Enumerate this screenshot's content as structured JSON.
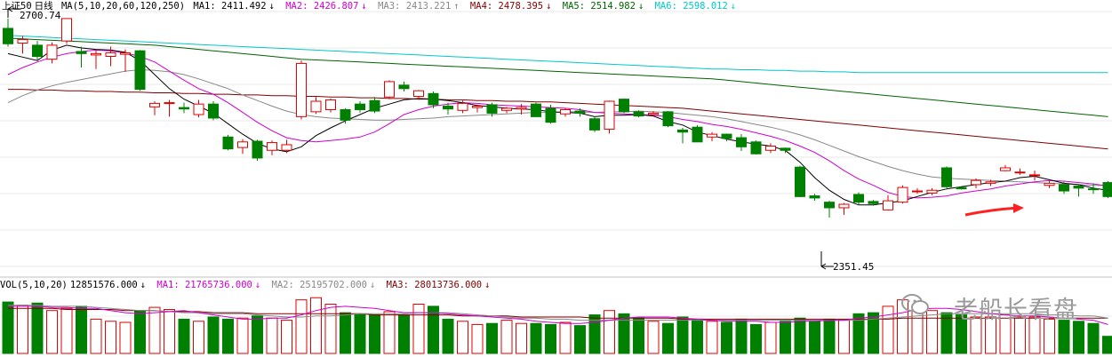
{
  "index_name": "上证50",
  "period": "日线",
  "ma_header": {
    "label": "MA(5,10,20,60,120,250)",
    "items": [
      {
        "name": "MA1",
        "value": "2411.492",
        "arrow": "↓",
        "color": "#000000"
      },
      {
        "name": "MA2",
        "value": "2426.807",
        "arrow": "↓",
        "color": "#d000d0"
      },
      {
        "name": "MA3",
        "value": "2413.221",
        "arrow": "↑",
        "color": "#888888"
      },
      {
        "name": "MA4",
        "value": "2478.395",
        "arrow": "↓",
        "color": "#800000"
      },
      {
        "name": "MA5",
        "value": "2514.982",
        "arrow": "↓",
        "color": "#006400"
      },
      {
        "name": "MA6",
        "value": "2598.012",
        "arrow": "↓",
        "color": "#00c8c8"
      }
    ]
  },
  "price_annotations": {
    "high_label": "2700.74",
    "low_label": "2351.45"
  },
  "vol_header": {
    "label": "VOL(5,10,20)",
    "value": "12851576.000",
    "arrow": "↓",
    "items": [
      {
        "name": "MA1",
        "value": "21765736.000",
        "arrow": "↓",
        "color": "#d000d0"
      },
      {
        "name": "MA2",
        "value": "25195702.000",
        "arrow": "↓",
        "color": "#888888"
      },
      {
        "name": "MA3",
        "value": "28013736.000",
        "arrow": "↓",
        "color": "#800000"
      }
    ]
  },
  "watermark": "老船长看盘",
  "colors": {
    "up": "#e00000",
    "down": "#008000",
    "ma_fast": "#000000",
    "ma_mid": "#d000d0",
    "ma_slow": "#888888",
    "ma60": "#800000",
    "ma120": "#006400",
    "ma250": "#00c8c8",
    "arrow": "#ff2020"
  },
  "chart_data": {
    "type": "candlestick",
    "price_range": [
      2340,
      2710
    ],
    "candles": [
      [
        2686,
        2664,
        2700,
        2660
      ],
      [
        2665,
        2670,
        2675,
        2650
      ],
      [
        2662,
        2646,
        2668,
        2640
      ],
      [
        2642,
        2662,
        2666,
        2636
      ],
      [
        2668,
        2700,
        2700,
        2664
      ],
      [
        2653,
        2650,
        2660,
        2630
      ],
      [
        2648,
        2650,
        2655,
        2628
      ],
      [
        2646,
        2651,
        2660,
        2632
      ],
      [
        2649,
        2651,
        2656,
        2624
      ],
      [
        2654,
        2599,
        2655,
        2597
      ],
      [
        2574,
        2579,
        2582,
        2562
      ],
      [
        2579,
        2580,
        2584,
        2560
      ],
      [
        2573,
        2571,
        2580,
        2565
      ],
      [
        2563,
        2578,
        2584,
        2559
      ],
      [
        2578,
        2558,
        2582,
        2555
      ],
      [
        2531,
        2514,
        2534,
        2512
      ],
      [
        2516,
        2524,
        2528,
        2507
      ],
      [
        2525,
        2501,
        2527,
        2497
      ],
      [
        2512,
        2523,
        2526,
        2505
      ],
      [
        2512,
        2520,
        2527,
        2508
      ],
      [
        2560,
        2636,
        2640,
        2556
      ],
      [
        2567,
        2582,
        2588,
        2564
      ],
      [
        2570,
        2584,
        2586,
        2566
      ],
      [
        2570,
        2555,
        2572,
        2550
      ],
      [
        2578,
        2570,
        2582,
        2566
      ],
      [
        2583,
        2568,
        2588,
        2565
      ],
      [
        2588,
        2610,
        2612,
        2585
      ],
      [
        2605,
        2600,
        2610,
        2596
      ],
      [
        2589,
        2597,
        2598,
        2584
      ],
      [
        2593,
        2577,
        2596,
        2572
      ],
      [
        2575,
        2571,
        2580,
        2563
      ],
      [
        2569,
        2579,
        2583,
        2565
      ],
      [
        2573,
        2575,
        2577,
        2566
      ],
      [
        2577,
        2565,
        2580,
        2560
      ],
      [
        2569,
        2572,
        2574,
        2565
      ],
      [
        2571,
        2573,
        2578,
        2563
      ],
      [
        2578,
        2560,
        2580,
        2560
      ],
      [
        2572,
        2552,
        2577,
        2550
      ],
      [
        2564,
        2570,
        2572,
        2560
      ],
      [
        2568,
        2565,
        2572,
        2560
      ],
      [
        2557,
        2541,
        2560,
        2538
      ],
      [
        2542,
        2582,
        2583,
        2536
      ],
      [
        2585,
        2567,
        2586,
        2565
      ],
      [
        2567,
        2561,
        2569,
        2559
      ],
      [
        2563,
        2565,
        2568,
        2560
      ],
      [
        2567,
        2547,
        2568,
        2545
      ],
      [
        2541,
        2538,
        2544,
        2522
      ],
      [
        2545,
        2524,
        2548,
        2524
      ],
      [
        2531,
        2535,
        2538,
        2525
      ],
      [
        2535,
        2529,
        2536,
        2525
      ],
      [
        2530,
        2517,
        2535,
        2511
      ],
      [
        2524,
        2507,
        2526,
        2506
      ],
      [
        2512,
        2518,
        2522,
        2508
      ],
      [
        2515,
        2512,
        2516,
        2508
      ],
      [
        2488,
        2446,
        2490,
        2445
      ],
      [
        2447,
        2444,
        2450,
        2440
      ],
      [
        2438,
        2430,
        2440,
        2416
      ],
      [
        2430,
        2435,
        2437,
        2420
      ],
      [
        2449,
        2438,
        2452,
        2434
      ],
      [
        2439,
        2436,
        2441,
        2433
      ],
      [
        2427,
        2440,
        2448,
        2426
      ],
      [
        2438,
        2459,
        2462,
        2436
      ],
      [
        2453,
        2454,
        2458,
        2450
      ],
      [
        2451,
        2455,
        2458,
        2448
      ],
      [
        2487,
        2460,
        2489,
        2458
      ],
      [
        2459,
        2457,
        2460,
        2456
      ],
      [
        2463,
        2469,
        2472,
        2458
      ],
      [
        2465,
        2467,
        2470,
        2461
      ],
      [
        2483,
        2487,
        2491,
        2482
      ],
      [
        2481,
        2481,
        2486,
        2477
      ],
      [
        2476,
        2477,
        2483,
        2469
      ],
      [
        2462,
        2465,
        2468,
        2458
      ],
      [
        2463,
        2454,
        2467,
        2450
      ],
      [
        2461,
        2458,
        2464,
        2446
      ],
      [
        2457,
        2456,
        2465,
        2450
      ],
      [
        2466,
        2446,
        2468,
        2444
      ]
    ],
    "ma_fast": [
      2650,
      2645,
      2640,
      2655,
      2662,
      2658,
      2656,
      2655,
      2652,
      2640,
      2620,
      2600,
      2585,
      2575,
      2565,
      2550,
      2535,
      2522,
      2514,
      2510,
      2517,
      2533,
      2544,
      2554,
      2563,
      2572,
      2578,
      2584,
      2586,
      2585,
      2583,
      2580,
      2576,
      2574,
      2572,
      2571,
      2570,
      2567,
      2566,
      2565,
      2560,
      2562,
      2562,
      2563,
      2561,
      2553,
      2548,
      2538,
      2533,
      2528,
      2524,
      2521,
      2518,
      2512,
      2495,
      2473,
      2455,
      2442,
      2434,
      2434,
      2437,
      2440,
      2446,
      2452,
      2457,
      2460,
      2463,
      2466,
      2468,
      2473,
      2475,
      2470,
      2465,
      2463,
      2458,
      2455
    ],
    "ma_mid": [
      2620,
      2630,
      2638,
      2645,
      2650,
      2653,
      2655,
      2654,
      2651,
      2646,
      2638,
      2625,
      2612,
      2600,
      2592,
      2580,
      2566,
      2552,
      2540,
      2530,
      2526,
      2524,
      2526,
      2528,
      2531,
      2538,
      2550,
      2563,
      2570,
      2575,
      2578,
      2580,
      2579,
      2577,
      2576,
      2575,
      2574,
      2573,
      2572,
      2570,
      2566,
      2565,
      2564,
      2563,
      2562,
      2560,
      2556,
      2553,
      2549,
      2546,
      2542,
      2537,
      2532,
      2526,
      2518,
      2509,
      2497,
      2483,
      2471,
      2462,
      2452,
      2446,
      2444,
      2445,
      2447,
      2451,
      2454,
      2457,
      2461,
      2464,
      2467,
      2469,
      2468,
      2466,
      2464,
      2461
    ],
    "ma_slow": [
      2580,
      2590,
      2598,
      2604,
      2609,
      2613,
      2617,
      2621,
      2625,
      2627,
      2626,
      2624,
      2620,
      2614,
      2607,
      2600,
      2591,
      2583,
      2575,
      2568,
      2563,
      2560,
      2558,
      2557,
      2556,
      2555,
      2555,
      2556,
      2557,
      2558,
      2560,
      2561,
      2562,
      2563,
      2564,
      2565,
      2566,
      2566,
      2567,
      2567,
      2566,
      2567,
      2567,
      2568,
      2567,
      2566,
      2564,
      2562,
      2560,
      2557,
      2553,
      2549,
      2545,
      2540,
      2534,
      2527,
      2519,
      2511,
      2503,
      2496,
      2489,
      2483,
      2478,
      2474,
      2472,
      2471,
      2470,
      2469,
      2468,
      2467,
      2466,
      2465,
      2464,
      2463,
      2462,
      2462
    ],
    "ma60": [
      2599,
      2599,
      2598,
      2598,
      2597,
      2597,
      2596,
      2596,
      2595,
      2595,
      2594,
      2594,
      2593,
      2593,
      2592,
      2592,
      2591,
      2591,
      2590,
      2590,
      2589,
      2589,
      2588,
      2588,
      2587,
      2587,
      2586,
      2586,
      2585,
      2585,
      2584,
      2584,
      2583,
      2583,
      2582,
      2582,
      2581,
      2581,
      2580,
      2579,
      2578,
      2577,
      2576,
      2575,
      2574,
      2573,
      2572,
      2570,
      2568,
      2566,
      2564,
      2562,
      2560,
      2558,
      2556,
      2554,
      2552,
      2550,
      2548,
      2546,
      2544,
      2542,
      2540,
      2538,
      2536,
      2534,
      2532,
      2530,
      2528,
      2526,
      2524,
      2522,
      2520,
      2518,
      2516,
      2514
    ],
    "ma120": [
      2672,
      2671,
      2670,
      2669,
      2668,
      2667,
      2666,
      2665,
      2664,
      2663,
      2662,
      2660,
      2658,
      2656,
      2654,
      2652,
      2650,
      2648,
      2646,
      2644,
      2642,
      2641,
      2640,
      2639,
      2638,
      2637,
      2636,
      2635,
      2634,
      2633,
      2632,
      2631,
      2630,
      2629,
      2628,
      2627,
      2626,
      2625,
      2624,
      2623,
      2622,
      2621,
      2620,
      2619,
      2618,
      2617,
      2616,
      2615,
      2614,
      2612,
      2610,
      2608,
      2606,
      2604,
      2602,
      2600,
      2598,
      2596,
      2594,
      2592,
      2590,
      2588,
      2586,
      2584,
      2582,
      2580,
      2578,
      2576,
      2574,
      2572,
      2570,
      2568,
      2566,
      2564,
      2562,
      2560
    ],
    "ma250": [
      2676,
      2675,
      2674,
      2673,
      2672,
      2671,
      2670,
      2669,
      2668,
      2667,
      2666,
      2665,
      2664,
      2663,
      2662,
      2661,
      2660,
      2659,
      2658,
      2657,
      2656,
      2655,
      2654,
      2653,
      2652,
      2651,
      2650,
      2649,
      2648,
      2647,
      2646,
      2645,
      2644,
      2643,
      2642,
      2641,
      2640,
      2639,
      2638,
      2637,
      2636,
      2635,
      2634,
      2633,
      2632,
      2631,
      2630,
      2629,
      2628,
      2628,
      2627,
      2627,
      2626,
      2626,
      2625,
      2625,
      2624,
      2624,
      2623,
      2623,
      2623,
      2623,
      2623,
      2623,
      2623,
      2623,
      2623,
      2623,
      2623,
      2623,
      2623,
      2623,
      2623,
      2623,
      2623,
      2623
    ],
    "volume": [
      48,
      45,
      47,
      40,
      42,
      44,
      32,
      30,
      29,
      40,
      43,
      41,
      32,
      30,
      34,
      32,
      33,
      35,
      33,
      31,
      50,
      52,
      46,
      38,
      37,
      36,
      39,
      36,
      46,
      44,
      32,
      30,
      27,
      28,
      31,
      28,
      28,
      27,
      29,
      26,
      36,
      40,
      37,
      33,
      30,
      28,
      34,
      32,
      30,
      29,
      32,
      27,
      29,
      30,
      33,
      30,
      32,
      31,
      37,
      38,
      44,
      50,
      42,
      40,
      38,
      36,
      34,
      34,
      36,
      34,
      34,
      32,
      31,
      30,
      28,
      16
    ],
    "vol_ma_fast": [
      44,
      44,
      44,
      43,
      43,
      42,
      42,
      40,
      38,
      37,
      38,
      39,
      40,
      38,
      36,
      34,
      32,
      32,
      33,
      33,
      36,
      40,
      43,
      44,
      43,
      42,
      40,
      38,
      38,
      38,
      37,
      36,
      35,
      34,
      33,
      32,
      30,
      29,
      28,
      28,
      29,
      31,
      33,
      34,
      34,
      34,
      33,
      32,
      31,
      30,
      30,
      30,
      29,
      29,
      30,
      30,
      31,
      31,
      33,
      34,
      36,
      38,
      41,
      42,
      42,
      41,
      39,
      37,
      36,
      35,
      35,
      34,
      33,
      32,
      31,
      27
    ],
    "vol_ma_mid": [
      45,
      45,
      45,
      44,
      44,
      44,
      43,
      42,
      41,
      40,
      40,
      39,
      38,
      38,
      37,
      37,
      37,
      36,
      35,
      34,
      34,
      35,
      35,
      36,
      37,
      37,
      37,
      37,
      38,
      38,
      38,
      37,
      36,
      35,
      34,
      33,
      33,
      32,
      32,
      31,
      31,
      31,
      31,
      31,
      31,
      31,
      31,
      31,
      31,
      31,
      31,
      31,
      31,
      31,
      31,
      31,
      31,
      31,
      31,
      32,
      33,
      34,
      35,
      36,
      37,
      37,
      37,
      37,
      37,
      37,
      37,
      36,
      36,
      35,
      35,
      33
    ],
    "vol_ma_slow": [
      42,
      42,
      42,
      42,
      41,
      41,
      41,
      41,
      40,
      40,
      40,
      39,
      39,
      39,
      38,
      38,
      38,
      37,
      37,
      37,
      37,
      37,
      37,
      37,
      37,
      36,
      36,
      36,
      36,
      36,
      36,
      35,
      35,
      35,
      35,
      34,
      34,
      34,
      34,
      34,
      33,
      33,
      33,
      33,
      33,
      33,
      32,
      32,
      32,
      32,
      32,
      32,
      32,
      32,
      32,
      32,
      32,
      32,
      32,
      32,
      32,
      33,
      33,
      33,
      33,
      33,
      33,
      33,
      33,
      33,
      33,
      33,
      33,
      33,
      33,
      33
    ],
    "vol_range": [
      0,
      58
    ]
  }
}
